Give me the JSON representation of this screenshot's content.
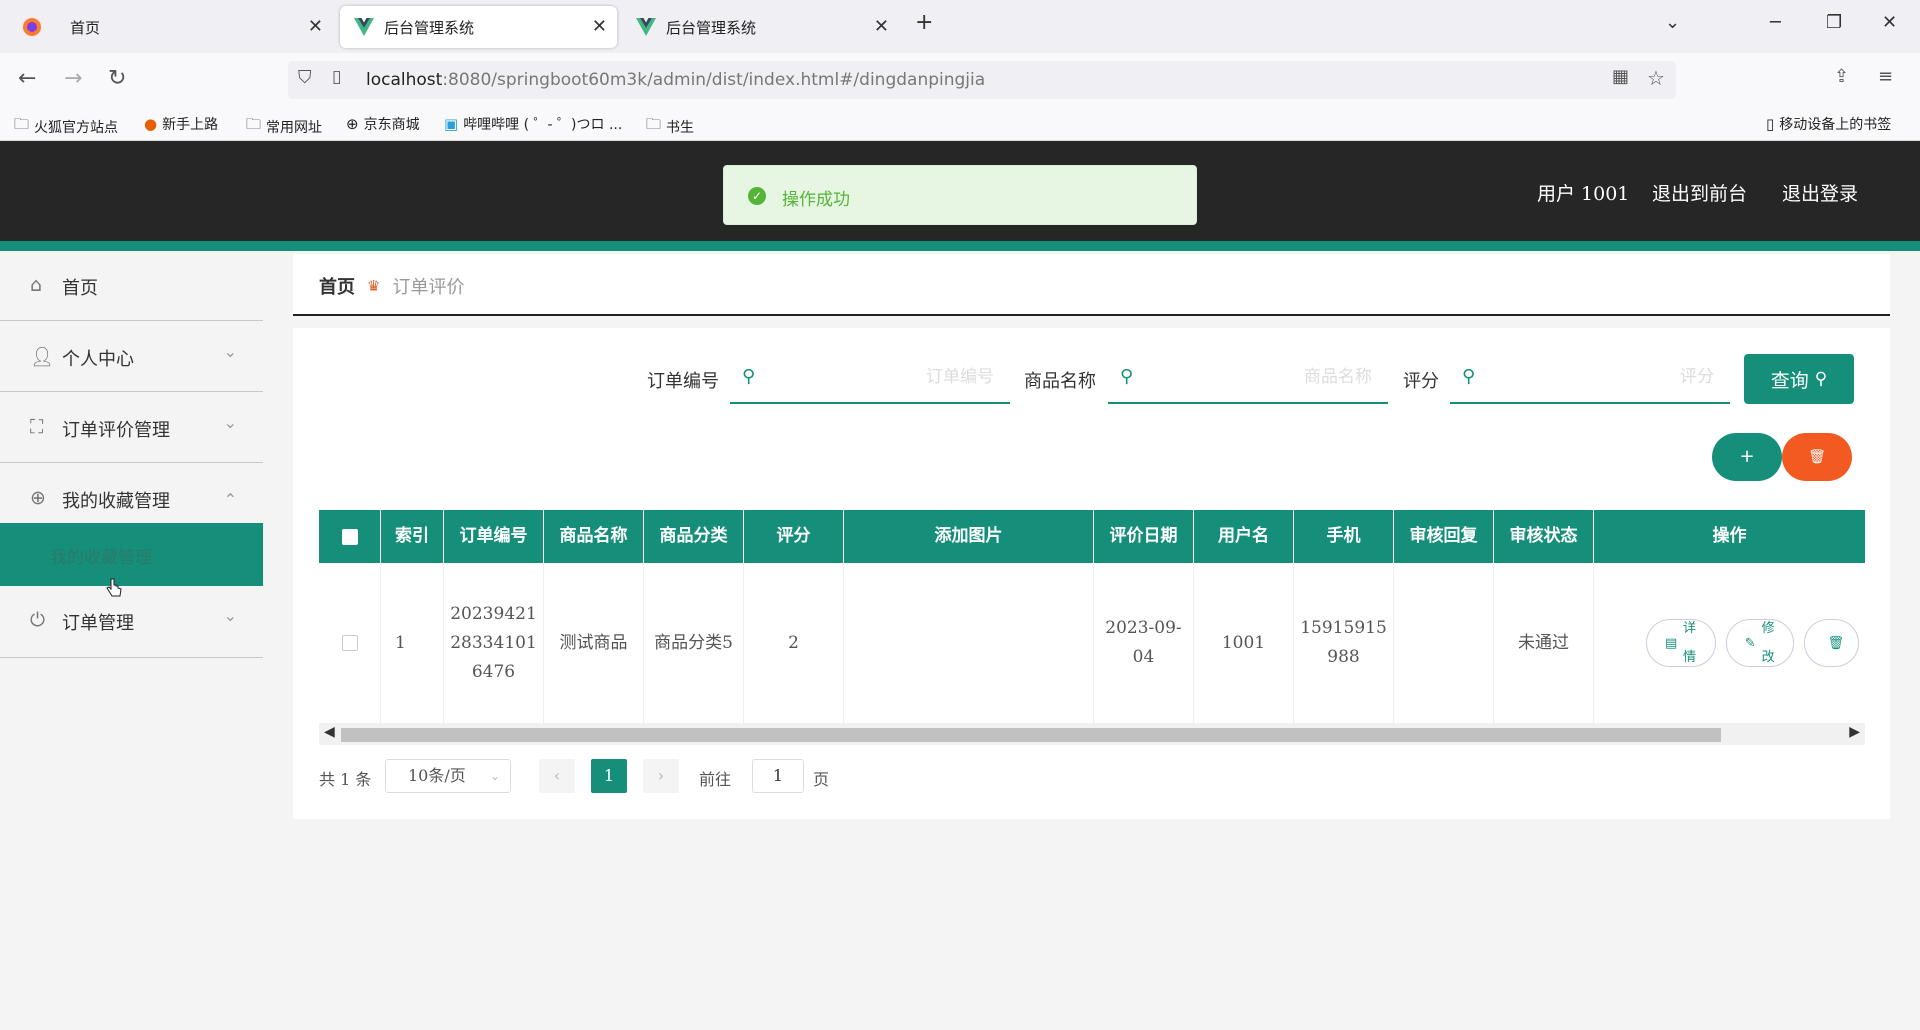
{
  "browser": {
    "tabs": [
      {
        "title": "首页",
        "active": false
      },
      {
        "title": "后台管理系统",
        "active": true
      },
      {
        "title": "后台管理系统",
        "active": false
      }
    ],
    "new_tab": "+",
    "url_host": "localhost",
    "url_rest": ":8080/springboot60m3k/admin/dist/index.html#/dingdanpingjia",
    "bookmarks": [
      "火狐官方站点",
      "新手上路",
      "常用网址",
      "京东商城",
      "哔哩哔哩 ( ゜- ゜)つロ ...",
      "书生"
    ],
    "mobile_bookmarks": "移动设备上的书签"
  },
  "header": {
    "user": "用户 1001",
    "to_front": "退出到前台",
    "logout": "退出登录",
    "toast": "操作成功"
  },
  "sidebar": {
    "items": [
      {
        "label": "首页",
        "icon": "home-icon"
      },
      {
        "label": "个人中心",
        "icon": "user-icon"
      },
      {
        "label": "订单评价管理",
        "icon": "frame-icon"
      },
      {
        "label": "我的收藏管理",
        "icon": "globe-icon"
      },
      {
        "label": "订单管理",
        "icon": "power-icon"
      }
    ],
    "submenu_item": "我的收藏管理"
  },
  "breadcrumb": {
    "home": "首页",
    "current": "订单评价"
  },
  "search": {
    "order_no_label": "订单编号",
    "order_no_placeholder": "订单编号",
    "product_label": "商品名称",
    "product_placeholder": "商品名称",
    "rating_label": "评分",
    "rating_placeholder": "评分",
    "query_button": "查询"
  },
  "actions": {
    "add": "+",
    "delete": "🗑"
  },
  "table": {
    "headers": [
      "索引",
      "订单编号",
      "商品名称",
      "商品分类",
      "评分",
      "添加图片",
      "评价日期",
      "用户名",
      "手机",
      "审核回复",
      "审核状态",
      "操作"
    ],
    "rows": [
      {
        "index": "1",
        "order_no": "20239421283341016476",
        "product": "测试商品",
        "category": "商品分类5",
        "rating": "2",
        "image": "",
        "date": "2023-09-04",
        "username": "1001",
        "phone": "15915915988",
        "reply": "",
        "status": "未通过"
      }
    ],
    "ops": {
      "detail": "详情",
      "edit": "修改"
    }
  },
  "pagination": {
    "total": "共 1 条",
    "page_size": "10条/页",
    "current": "1",
    "goto_label": "前往",
    "goto_value": "1",
    "page_suffix": "页"
  },
  "colors": {
    "primary": "#158f7a",
    "header": "#262626",
    "danger": "#f25a22"
  }
}
